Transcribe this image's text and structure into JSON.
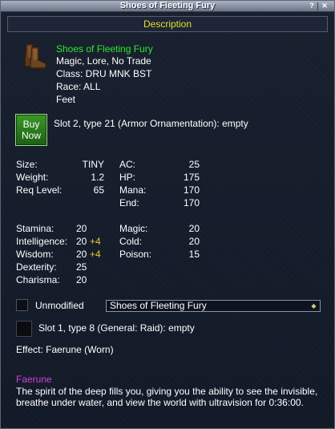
{
  "window": {
    "title": "Shoes of Fleeting Fury",
    "help_glyph": "?",
    "close_glyph": "✕"
  },
  "tab": {
    "label": "Description"
  },
  "item": {
    "name": "Shoes of Fleeting Fury",
    "flags": "Magic, Lore, No Trade",
    "class_line": "Class: DRU MNK BST",
    "race_line": "Race: ALL",
    "slot_line": "Feet",
    "icon": "boots-icon"
  },
  "buy_button": {
    "line1": "Buy",
    "line2": "Now"
  },
  "aug_slot_2": "Slot 2, type 21 (Armor Ornamentation): empty",
  "stats_left": [
    {
      "label": "Size:",
      "value": "TINY"
    },
    {
      "label": "Weight:",
      "value": "1.2"
    },
    {
      "label": "Req Level:",
      "value": "65"
    }
  ],
  "stats_right": [
    {
      "label": "AC:",
      "value": "25"
    },
    {
      "label": "HP:",
      "value": "175"
    },
    {
      "label": "Mana:",
      "value": "170"
    },
    {
      "label": "End:",
      "value": "170"
    }
  ],
  "attributes": [
    {
      "label": "Stamina:",
      "value": "20",
      "bonus": ""
    },
    {
      "label": "Intelligence:",
      "value": "20",
      "bonus": "+4"
    },
    {
      "label": "Wisdom:",
      "value": "20",
      "bonus": "+4"
    },
    {
      "label": "Dexterity:",
      "value": "25",
      "bonus": ""
    },
    {
      "label": "Charisma:",
      "value": "20",
      "bonus": ""
    }
  ],
  "resists": [
    {
      "label": "Magic:",
      "value": "20"
    },
    {
      "label": "Cold:",
      "value": "20"
    },
    {
      "label": "Poison:",
      "value": "15"
    }
  ],
  "unmodified": {
    "label": "Unmodified",
    "checked": false
  },
  "variant_select": {
    "value": "Shoes of Fleeting Fury"
  },
  "aug_slot_1": "Slot 1, type 8 (General: Raid): empty",
  "effect_line": "Effect: Faerune (Worn)",
  "spell": {
    "name": "Faerune",
    "description": "The spirit of the deep fills you, giving you the ability to see the invisible, breathe under water, and view the world with ultravision for 0:36:00."
  },
  "colors": {
    "name_green": "#2ee82e",
    "bonus_yellow": "#e6c830",
    "tab_yellow": "#e6df2e",
    "spell_magenta": "#d040d8",
    "background": "#141c2c"
  }
}
